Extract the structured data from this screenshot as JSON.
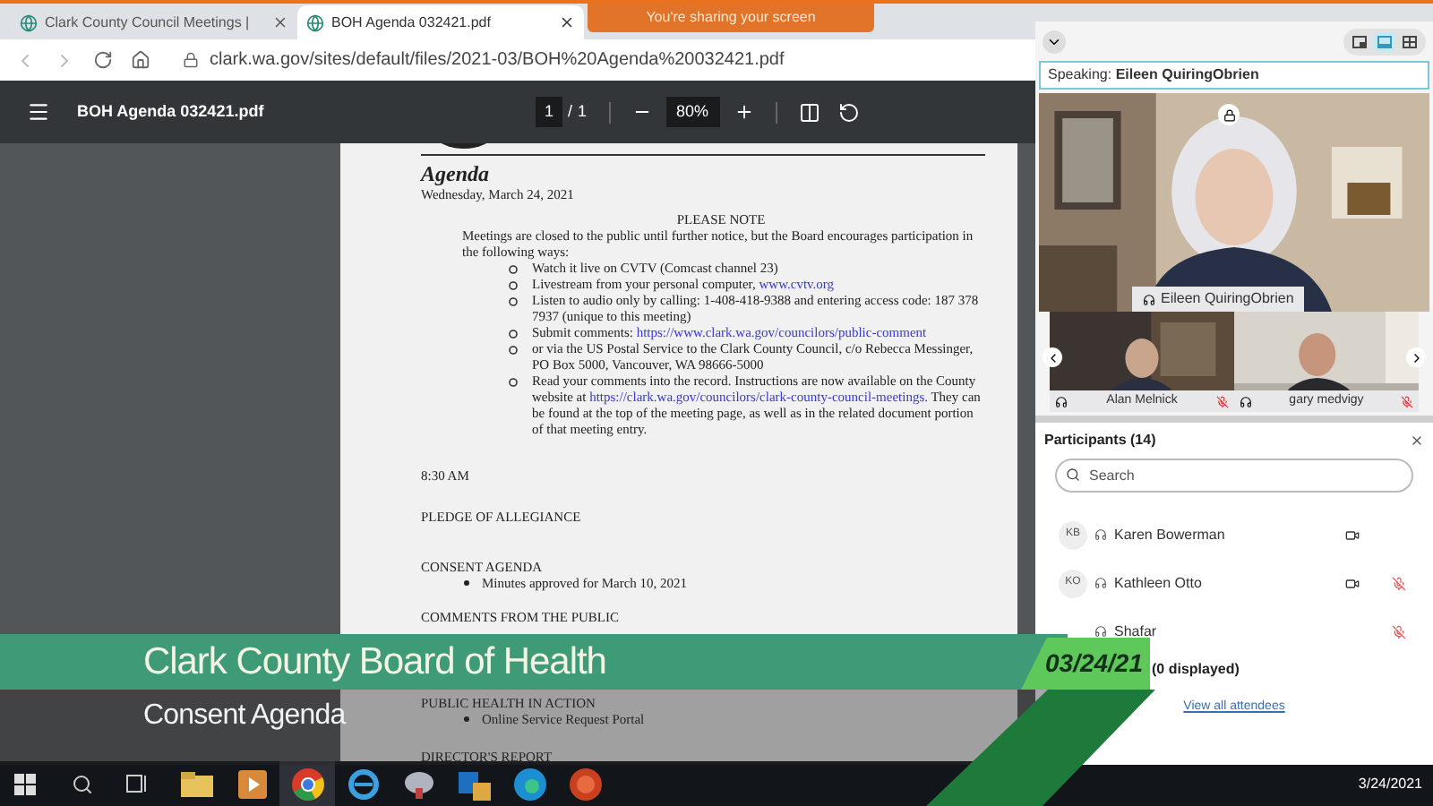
{
  "browser": {
    "tabs": [
      {
        "title": "Clark County Council Meetings |",
        "selected": false
      },
      {
        "title": "BOH Agenda 032421.pdf",
        "selected": true
      }
    ],
    "url": "clark.wa.gov/sites/default/files/2021-03/BOH%20Agenda%20032421.pdf"
  },
  "share_banner": "You're sharing your screen",
  "pdf_viewer": {
    "title": "BOH Agenda 032421.pdf",
    "page": "1",
    "separator": "/",
    "pages": "1",
    "zoom": "80%"
  },
  "document": {
    "heading": "Agenda",
    "date": "Wednesday, March 24, 2021",
    "note_title": "PLEASE NOTE",
    "note_intro": "Meetings are closed to the public until further notice, but the Board encourages participation in the following ways:",
    "note_items": [
      [
        {
          "kind": "plain",
          "text": "Watch it live on CVTV (Comcast channel 23)"
        }
      ],
      [
        {
          "kind": "plain",
          "text": "Livestream from your personal computer, "
        },
        {
          "kind": "link",
          "text": "www.cvtv.org"
        }
      ],
      [
        {
          "kind": "plain",
          "text": "Listen to audio only by calling: 1-408-418-9388 and entering access code: 187 378 7937 (unique to this meeting)"
        }
      ],
      [
        {
          "kind": "plain",
          "text": "Submit comments: "
        },
        {
          "kind": "link",
          "text": "https://www.clark.wa.gov/councilors/public-comment"
        }
      ],
      [
        {
          "kind": "plain",
          "text": "or via the US Postal Service to the Clark County Council, c/o Rebecca Messinger, PO Box 5000, Vancouver, WA 98666-5000"
        }
      ],
      [
        {
          "kind": "plain",
          "text": "Read your comments into the record. Instructions are now available on the County website at "
        },
        {
          "kind": "link",
          "text": "https://clark.wa.gov/councilors/clark-county-council-"
        },
        {
          "kind": "link",
          "text": "meetings."
        },
        {
          "kind": "plain",
          "text": " They can be found at the top of the meeting page, as well as in the related document portion of that meeting entry."
        }
      ]
    ],
    "sections": [
      {
        "title": "8:30 AM"
      },
      {
        "title": "PLEDGE OF ALLEGIANCE"
      },
      {
        "title": "CONSENT AGENDA",
        "items": [
          "Minutes approved for March 10, 2021"
        ]
      },
      {
        "title": "COMMENTS FROM THE PUBLIC"
      },
      {
        "title": "PUBLIC HEALTH IN ACTION",
        "items": [
          "Online Service Request Portal"
        ]
      },
      {
        "title": "DIRECTOR'S REPORT"
      }
    ]
  },
  "meeting": {
    "layouts": [
      {
        "kind": "float",
        "selected": false
      },
      {
        "kind": "stack",
        "selected": true
      },
      {
        "kind": "grid",
        "selected": false
      }
    ],
    "speaking": "Speaking: **Eileen QuiringObrien**",
    "main_video": {
      "name": "Eileen QuiringObrien",
      "muted": false
    },
    "thumbnails": [
      {
        "name": "Alan Melnick",
        "muted": true
      },
      {
        "name": "gary medvigy",
        "muted": true
      }
    ],
    "participants": {
      "title": "Participants (14)",
      "search": {
        "placeholder": "Search"
      },
      "rows": [
        {
          "initials": "KB",
          "name": "Karen Bowerman",
          "video": true,
          "muted": false
        },
        {
          "initials": "KO",
          "name": "Kathleen Otto",
          "video": true,
          "muted": true
        },
        {
          "name": "Shafar",
          "video": false,
          "muted": true
        }
      ],
      "attendees": "(0 displayed)",
      "view_all": "View all attendees"
    }
  },
  "lower_third": {
    "title": "Clark County Board of Health",
    "subtitle": "Consent Agenda",
    "date": "03/24/21"
  },
  "taskbar": {
    "apps": [
      {
        "kind": "folder",
        "selected": false
      },
      {
        "kind": "media",
        "selected": false
      },
      {
        "kind": "chrome",
        "selected": true
      },
      {
        "kind": "ie",
        "selected": false
      },
      {
        "kind": "tool",
        "selected": false
      },
      {
        "kind": "outlook",
        "selected": false
      },
      {
        "kind": "edge",
        "selected": false
      },
      {
        "kind": "powerpoint",
        "selected": false
      }
    ],
    "clock": "3/24/2021"
  }
}
